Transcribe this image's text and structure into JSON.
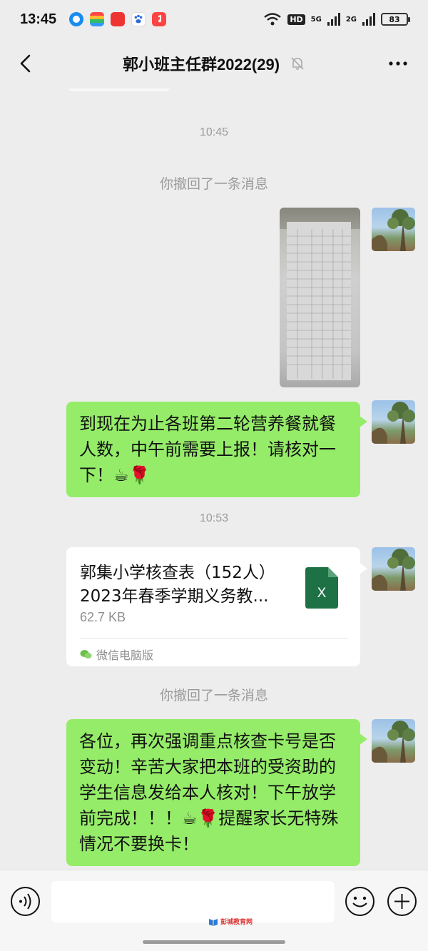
{
  "status_bar": {
    "time": "13:45",
    "app_icons": [
      "blue-circle-app-icon",
      "rainbow-app-icon",
      "toutiao-app-icon",
      "baidu-paw-app-icon",
      "music-app-icon"
    ],
    "hd_label": "HD",
    "network_5g": "5G",
    "network_2g": "2G",
    "battery": "83"
  },
  "header": {
    "title": "郭小班主任群2022(29)"
  },
  "messages": {
    "time_1": "10:45",
    "recall_1": "你撤回了一条消息",
    "text_1": "到现在为止各班第二轮营养餐就餐人数，中午前需要上报！请核对一下！☕🌹",
    "time_2": "10:53",
    "file": {
      "name_line1": "郭集小学核查表（152人）",
      "name_line2": "2023年春季学期义务教...",
      "size": "62.7 KB",
      "source": "微信电脑版",
      "icon_letter": "X"
    },
    "recall_2": "你撤回了一条消息",
    "text_2": "各位，再次强调重点核查卡号是否变动！辛苦大家把本班的受资助的学生信息发给本人核对！下午放学前完成！！！☕🌹提醒家长无特殊情况不要换卡！"
  },
  "watermark": "彭城教育网",
  "colors": {
    "background": "#ededed",
    "bubble_green": "#95ec69",
    "excel_green": "#1e7145",
    "muted_text": "#9a9a9a"
  }
}
